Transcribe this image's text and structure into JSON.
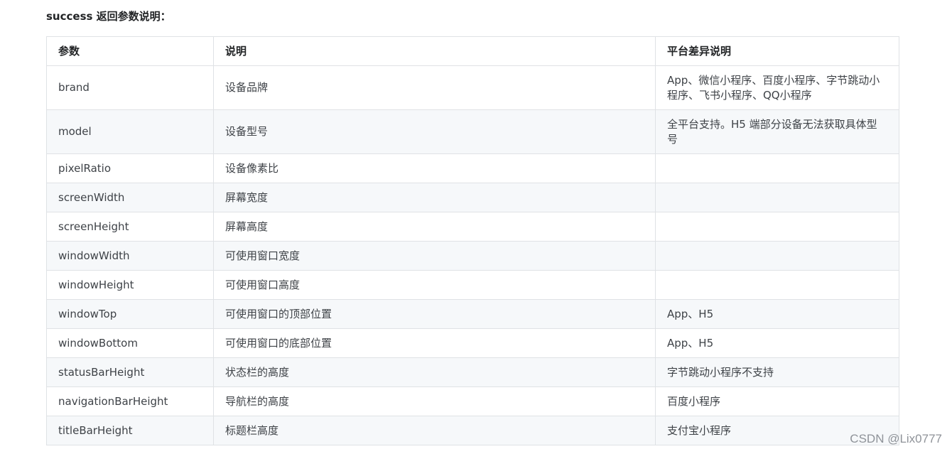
{
  "heading": "success 返回参数说明：",
  "table": {
    "headers": [
      "参数",
      "说明",
      "平台差异说明"
    ],
    "rows": [
      [
        "brand",
        "设备品牌",
        "App、微信小程序、百度小程序、字节跳动小程序、飞书小程序、QQ小程序"
      ],
      [
        "model",
        "设备型号",
        "全平台支持。H5 端部分设备无法获取具体型号"
      ],
      [
        "pixelRatio",
        "设备像素比",
        ""
      ],
      [
        "screenWidth",
        "屏幕宽度",
        ""
      ],
      [
        "screenHeight",
        "屏幕高度",
        ""
      ],
      [
        "windowWidth",
        "可使用窗口宽度",
        ""
      ],
      [
        "windowHeight",
        "可使用窗口高度",
        ""
      ],
      [
        "windowTop",
        "可使用窗口的顶部位置",
        "App、H5"
      ],
      [
        "windowBottom",
        "可使用窗口的底部位置",
        "App、H5"
      ],
      [
        "statusBarHeight",
        "状态栏的高度",
        "字节跳动小程序不支持"
      ],
      [
        "navigationBarHeight",
        "导航栏的高度",
        "百度小程序"
      ],
      [
        "titleBarHeight",
        "标题栏高度",
        "支付宝小程序"
      ]
    ]
  },
  "watermark": "CSDN @Lix0777"
}
